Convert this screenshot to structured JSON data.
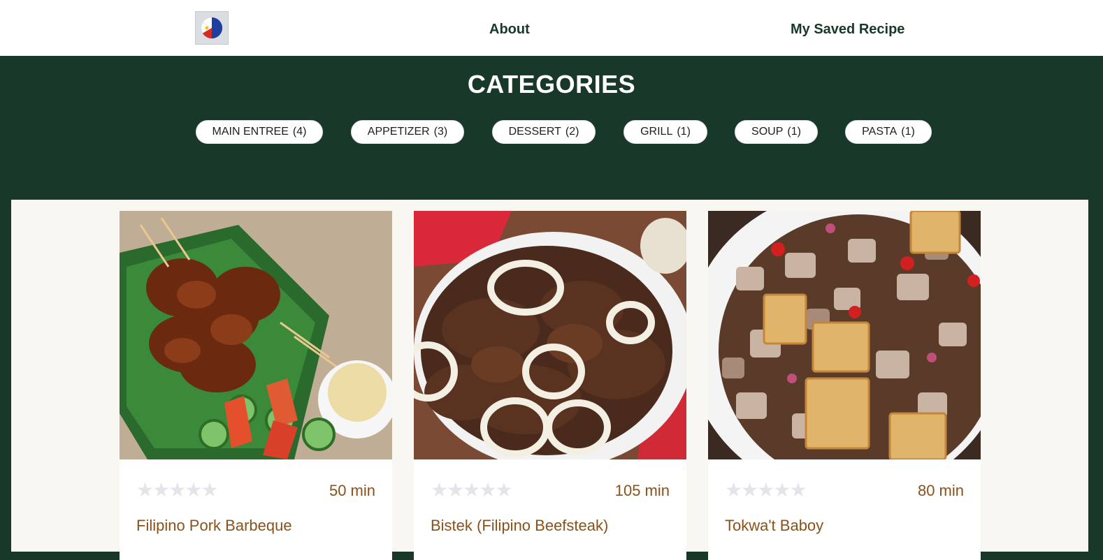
{
  "nav": {
    "logo_icon": "philippine-flag-logo-icon",
    "about": "About",
    "saved": "My Saved Recipe"
  },
  "categories": {
    "title": "CATEGORIES",
    "items": [
      {
        "label": "MAIN ENTREE",
        "count": "(4)"
      },
      {
        "label": "APPETIZER",
        "count": "(3)"
      },
      {
        "label": "DESSERT",
        "count": "(2)"
      },
      {
        "label": "GRILL",
        "count": "(1)"
      },
      {
        "label": "SOUP",
        "count": "(1)"
      },
      {
        "label": "PASTA",
        "count": "(1)"
      }
    ]
  },
  "recipes": [
    {
      "title": "Filipino Pork Barbeque",
      "time": "50 min",
      "rating": 0,
      "image": "pork-barbeque-skewers-photo"
    },
    {
      "title": "Bistek (Filipino Beefsteak)",
      "time": "105 min",
      "rating": 0,
      "image": "beefsteak-with-onion-rings-photo"
    },
    {
      "title": "Tokwa't Baboy",
      "time": "80 min",
      "rating": 0,
      "image": "tofu-and-pork-photo"
    }
  ],
  "colors": {
    "brand_dark_green": "#18382a",
    "recipe_text_brown": "#8c5019",
    "star_empty": "#e4e4ea",
    "content_bg": "#f8f7f1"
  }
}
